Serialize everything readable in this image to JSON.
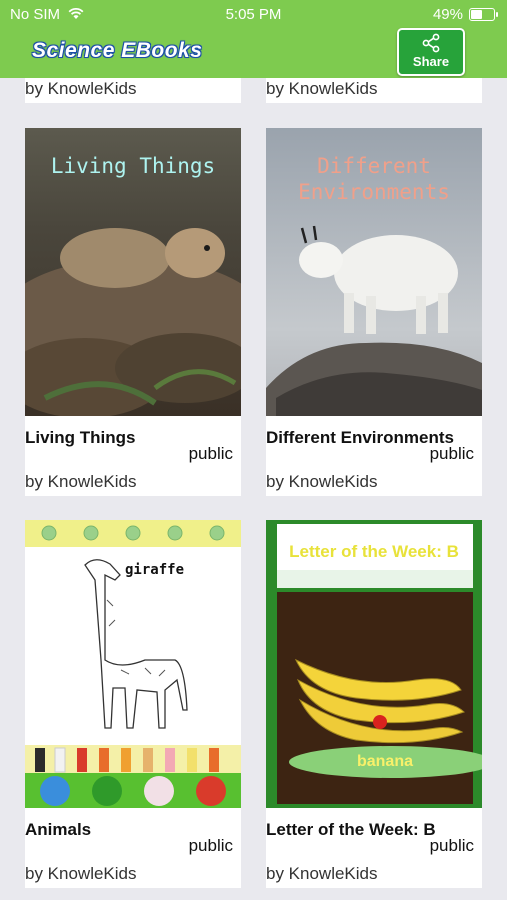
{
  "status": {
    "carrier": "No SIM",
    "time": "5:05 PM",
    "battery": "49%"
  },
  "header": {
    "app_title": "Science EBooks",
    "share_label": "Share"
  },
  "partial_row": [
    {
      "author": "by KnowleKids"
    },
    {
      "author": "by KnowleKids"
    }
  ],
  "books": [
    {
      "title": "Living Things",
      "visibility": "public",
      "author": "by KnowleKids",
      "cover_text": "Living Things"
    },
    {
      "title": "Different Environments",
      "visibility": "public",
      "author": "by KnowleKids",
      "cover_text_1": "Different",
      "cover_text_2": "Environments"
    },
    {
      "title": "Animals",
      "visibility": "public",
      "author": "by KnowleKids",
      "cover_text": "giraffe"
    },
    {
      "title": "Letter of the Week: B",
      "visibility": "public",
      "author": "by KnowleKids",
      "cover_text": "Letter of the Week: B",
      "cover_caption": "banana"
    }
  ]
}
